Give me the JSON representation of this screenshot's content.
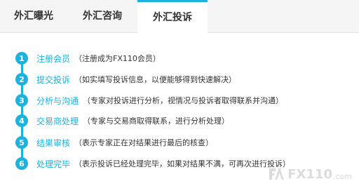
{
  "tabs": [
    {
      "label": "外汇曝光"
    },
    {
      "label": "外汇咨询"
    },
    {
      "label": "外汇投诉"
    }
  ],
  "steps": [
    {
      "number": "1",
      "title": "注册会员",
      "description": "（注册成为FX110会员）"
    },
    {
      "number": "2",
      "title": "提交投诉",
      "description": "（如实填写投诉信息，以便能够得到快速解决）"
    },
    {
      "number": "3",
      "title": "分析与沟通",
      "description": "（专家对投诉进行分析，视情况与投诉者取得联系并沟通）"
    },
    {
      "number": "4",
      "title": "交易商处理",
      "description": "（专家与交易商取得联系，进行分析处理）"
    },
    {
      "number": "5",
      "title": "结果审核",
      "description": "（表示专家正在对结果进行最后的核查）"
    },
    {
      "number": "6",
      "title": "处理完毕",
      "description": "（表示投诉已经处理完毕，如果对结果不满，可再次进行投诉）"
    }
  ],
  "watermark": {
    "text": "FX110",
    "suffix": ".com",
    "icon": "fx110-logo-icon"
  },
  "colors": {
    "accent": "#1ab3e0",
    "tab_bar": "#f5f5f5"
  }
}
